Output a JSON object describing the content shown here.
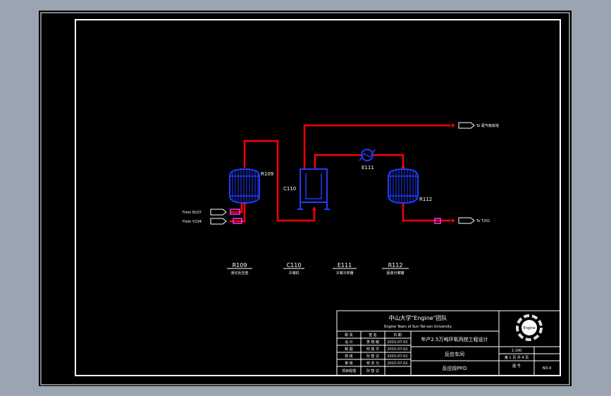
{
  "equipment": {
    "r109": {
      "tag": "R109",
      "desc": "液化反应釜"
    },
    "c110": {
      "tag": "C110",
      "desc": "冷凝机"
    },
    "e111": {
      "tag": "E111",
      "desc": "冷凝冷却器"
    },
    "r112": {
      "tag": "R112",
      "desc": "固液分离罐"
    }
  },
  "labels": {
    "r109": "R109",
    "c110": "C110",
    "e111": "E111",
    "r112": "R112",
    "from_b107": "From B107",
    "from_v104": "From V104",
    "to_top": "To 尾气吸收塔",
    "to_t201": "To T201"
  },
  "title_block": {
    "org": "中山大学\"Engine\"团队",
    "org_en": "Engine Team of Sun Yat-sen University",
    "project": "年产2.5万吨环氧丙烷工程设计",
    "section": "反应车间",
    "drawing": "反应段PFD",
    "logo_text": "Engine",
    "header": {
      "c1": "职 责",
      "c2": "签 名",
      "c3": "日 期"
    },
    "rows": [
      {
        "role": "设 计",
        "name": "李 晓 敏",
        "date": "2015-07-02"
      },
      {
        "role": "制 图",
        "name": "何 其 华",
        "date": "2015-07-02"
      },
      {
        "role": "校 核",
        "name": "孙 智 达",
        "date": "2015-07-02"
      },
      {
        "role": "审 核",
        "name": "林 杰 元",
        "date": "2015-07-02"
      },
      {
        "role": "项目经理",
        "name": "孙 智 达",
        "date": ""
      }
    ],
    "scale": "1:100",
    "sheet": "第 1 页  共 4 页",
    "drawing_no_label": "图 号",
    "drawing_no": "NO.4"
  },
  "colors": {
    "background": "#000000",
    "frame": "#ffffff",
    "process_line": "#ff0000",
    "equipment": "#1e3cff",
    "instrument": "#ff33ff"
  }
}
